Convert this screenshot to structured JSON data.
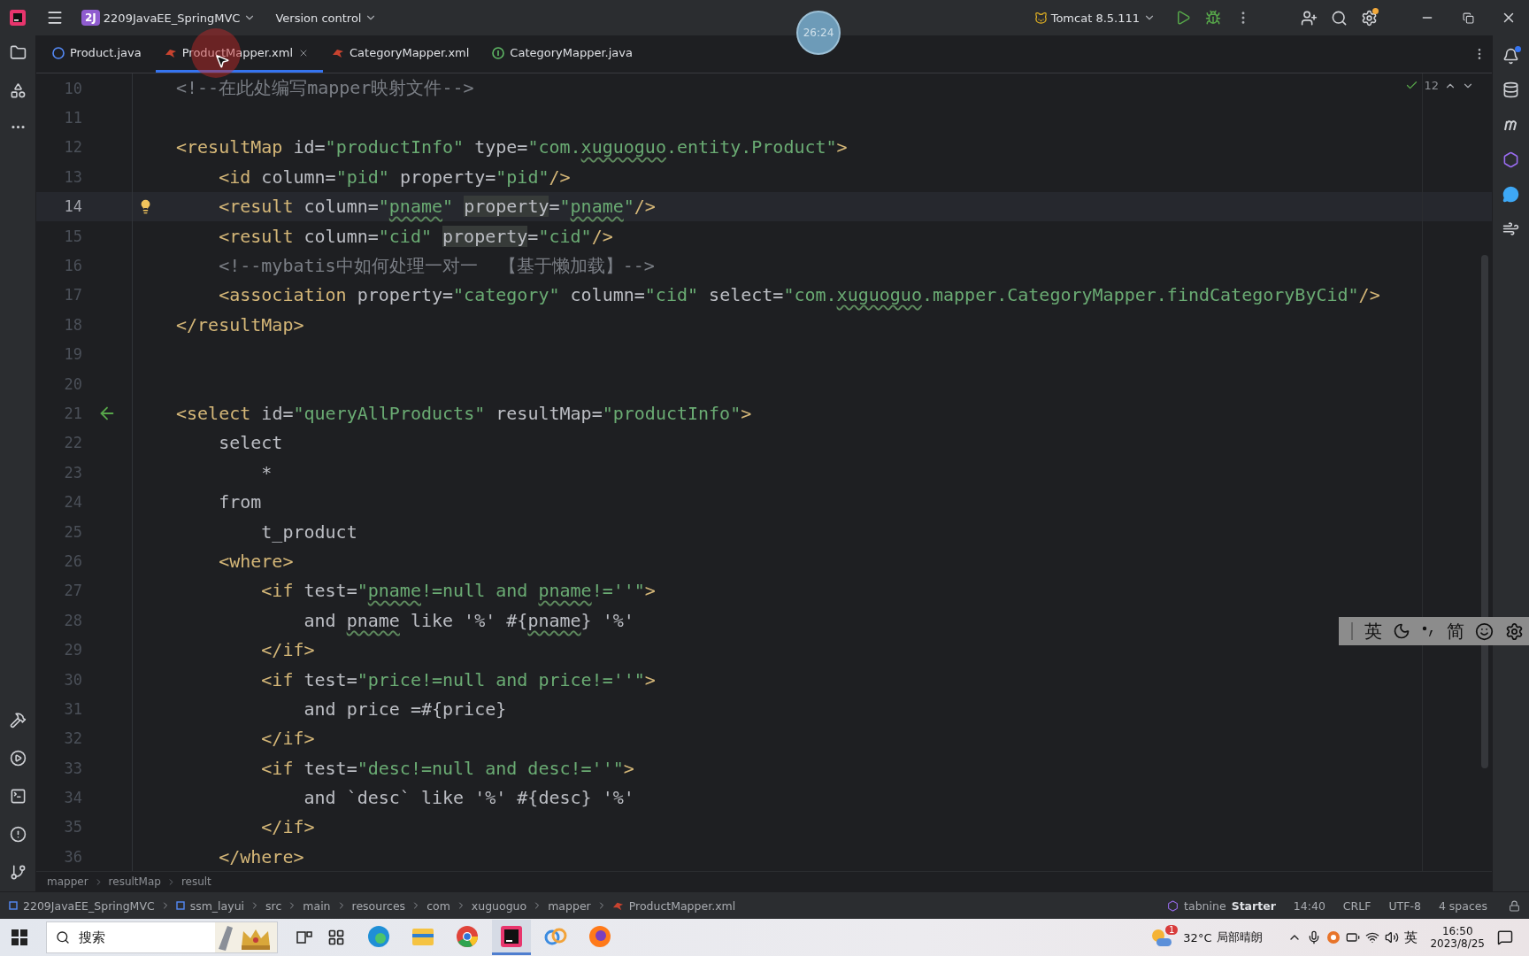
{
  "title_bar": {
    "project_badge": "2J",
    "project": "2209JavaEE_SpringMVC",
    "vcs": "Version control",
    "run_config": "Tomcat 8.5.111",
    "settings_badge": true
  },
  "recording_timer": "26:24",
  "tabs": [
    {
      "label": "Product.java",
      "kind": "java-class",
      "selected": false,
      "closable": false
    },
    {
      "label": "ProductMapper.xml",
      "kind": "xml",
      "selected": true,
      "closable": true
    },
    {
      "label": "CategoryMapper.xml",
      "kind": "xml",
      "selected": false,
      "closable": false
    },
    {
      "label": "CategoryMapper.java",
      "kind": "java-interface",
      "selected": false,
      "closable": false
    }
  ],
  "editor": {
    "inspections": "12",
    "lines": [
      {
        "number": "10",
        "current": false,
        "tokens": [
          {
            "kind": "comment",
            "text": "<!--在此处编写mapper映射文件-->"
          }
        ]
      },
      {
        "number": "11",
        "current": false
      },
      {
        "number": "12",
        "current": false,
        "tokens": [
          {
            "kind": "tag",
            "text": "<resultMap"
          },
          {
            "kind": "attr",
            "text": " id="
          },
          {
            "kind": "value",
            "text": "\"productInfo\""
          },
          {
            "kind": "attr",
            "text": " type="
          },
          {
            "kind": "value",
            "text": "\"com."
          },
          {
            "kind": "value",
            "text": "xuguoguo",
            "typo": true
          },
          {
            "kind": "value",
            "text": ".entity.Product\""
          },
          {
            "kind": "tag",
            "text": ">"
          }
        ]
      },
      {
        "number": "13",
        "current": false,
        "tokens": [
          {
            "kind": "tag",
            "text": "    <id"
          },
          {
            "kind": "attr",
            "text": " column="
          },
          {
            "kind": "value",
            "text": "\"pid\""
          },
          {
            "kind": "attr",
            "text": " property="
          },
          {
            "kind": "value",
            "text": "\"pid\""
          },
          {
            "kind": "tag",
            "text": "/>"
          }
        ]
      },
      {
        "number": "14",
        "current": true,
        "bulb": true,
        "tokens": [
          {
            "kind": "tag",
            "text": "    <result"
          },
          {
            "kind": "attr",
            "text": " column="
          },
          {
            "kind": "value",
            "text": "\""
          },
          {
            "kind": "value",
            "text": "pname",
            "typo": true
          },
          {
            "kind": "value",
            "text": "\" "
          },
          {
            "kind": "attr",
            "text": "property",
            "highlighted": true
          },
          {
            "kind": "attr",
            "text": "="
          },
          {
            "kind": "value",
            "text": "\""
          },
          {
            "kind": "value",
            "text": "pname",
            "typo": true
          },
          {
            "kind": "value",
            "text": "\""
          },
          {
            "kind": "tag",
            "text": "/>"
          }
        ]
      },
      {
        "number": "15",
        "current": false,
        "tokens": [
          {
            "kind": "tag",
            "text": "    <result"
          },
          {
            "kind": "attr",
            "text": " column="
          },
          {
            "kind": "value",
            "text": "\"cid\" "
          },
          {
            "kind": "attr",
            "text": "property",
            "highlighted": true
          },
          {
            "kind": "attr",
            "text": "="
          },
          {
            "kind": "value",
            "text": "\"cid\""
          },
          {
            "kind": "tag",
            "text": "/>"
          }
        ]
      },
      {
        "number": "16",
        "current": false,
        "tokens": [
          {
            "kind": "comment",
            "text": "    <!--mybatis中如何处理一对一  【基于懒加载】-->"
          }
        ]
      },
      {
        "number": "17",
        "current": false,
        "tokens": [
          {
            "kind": "tag",
            "text": "    <association"
          },
          {
            "kind": "attr",
            "text": " property="
          },
          {
            "kind": "value",
            "text": "\"category\""
          },
          {
            "kind": "attr",
            "text": " column="
          },
          {
            "kind": "value",
            "text": "\"cid\""
          },
          {
            "kind": "attr",
            "text": " select="
          },
          {
            "kind": "value",
            "text": "\"com."
          },
          {
            "kind": "value",
            "text": "xuguoguo",
            "typo": true
          },
          {
            "kind": "value",
            "text": ".mapper.CategoryMapper.findCategoryByCid\""
          },
          {
            "kind": "tag",
            "text": "/>"
          }
        ]
      },
      {
        "number": "18",
        "current": false,
        "tokens": [
          {
            "kind": "tag",
            "text": "</resultMap>"
          }
        ]
      },
      {
        "number": "19",
        "current": false
      },
      {
        "number": "20",
        "current": false
      },
      {
        "number": "21",
        "current": false,
        "arrow": true,
        "tokens": [
          {
            "kind": "tag",
            "text": "<select"
          },
          {
            "kind": "attr",
            "text": " id="
          },
          {
            "kind": "value",
            "text": "\"queryAllProducts\""
          },
          {
            "kind": "attr",
            "text": " resultMap="
          },
          {
            "kind": "value",
            "text": "\"productInfo\""
          },
          {
            "kind": "tag",
            "text": ">"
          }
        ]
      },
      {
        "number": "22",
        "current": false,
        "tokens": [
          {
            "kind": "text",
            "text": "    select"
          }
        ]
      },
      {
        "number": "23",
        "current": false,
        "tokens": [
          {
            "kind": "text",
            "text": "        *"
          }
        ]
      },
      {
        "number": "24",
        "current": false,
        "tokens": [
          {
            "kind": "text",
            "text": "    from"
          }
        ]
      },
      {
        "number": "25",
        "current": false,
        "tokens": [
          {
            "kind": "text",
            "text": "        t_product"
          }
        ]
      },
      {
        "number": "26",
        "current": false,
        "tokens": [
          {
            "kind": "tag",
            "text": "    <where>"
          }
        ]
      },
      {
        "number": "27",
        "current": false,
        "tokens": [
          {
            "kind": "tag",
            "text": "        <if"
          },
          {
            "kind": "attr",
            "text": " test="
          },
          {
            "kind": "value",
            "text": "\""
          },
          {
            "kind": "value",
            "text": "pname",
            "typo": true
          },
          {
            "kind": "value",
            "text": "!=null and "
          },
          {
            "kind": "value",
            "text": "pname",
            "typo": true
          },
          {
            "kind": "value",
            "text": "!=''\""
          },
          {
            "kind": "tag",
            "text": ">"
          }
        ]
      },
      {
        "number": "28",
        "current": false,
        "tokens": [
          {
            "kind": "text",
            "text": "            and "
          },
          {
            "kind": "text",
            "text": "pname",
            "typo": true
          },
          {
            "kind": "text",
            "text": " like '%' #{"
          },
          {
            "kind": "text",
            "text": "pname",
            "typo": true
          },
          {
            "kind": "text",
            "text": "} '%'"
          }
        ]
      },
      {
        "number": "29",
        "current": false,
        "tokens": [
          {
            "kind": "tag",
            "text": "        </if>"
          }
        ]
      },
      {
        "number": "30",
        "current": false,
        "tokens": [
          {
            "kind": "tag",
            "text": "        <if"
          },
          {
            "kind": "attr",
            "text": " test="
          },
          {
            "kind": "value",
            "text": "\"price!=null and price!=''\""
          },
          {
            "kind": "tag",
            "text": ">"
          }
        ]
      },
      {
        "number": "31",
        "current": false,
        "tokens": [
          {
            "kind": "text",
            "text": "            and price =#{price}"
          }
        ]
      },
      {
        "number": "32",
        "current": false,
        "tokens": [
          {
            "kind": "tag",
            "text": "        </if>"
          }
        ]
      },
      {
        "number": "33",
        "current": false,
        "tokens": [
          {
            "kind": "tag",
            "text": "        <if"
          },
          {
            "kind": "attr",
            "text": " test="
          },
          {
            "kind": "value",
            "text": "\"desc!=null and desc!=''\""
          },
          {
            "kind": "tag",
            "text": ">"
          }
        ]
      },
      {
        "number": "34",
        "current": false,
        "tokens": [
          {
            "kind": "text",
            "text": "            and `desc` like '%' #{desc} '%'"
          }
        ]
      },
      {
        "number": "35",
        "current": false,
        "tokens": [
          {
            "kind": "tag",
            "text": "        </if>"
          }
        ]
      },
      {
        "number": "36",
        "current": false,
        "tokens": [
          {
            "kind": "tag",
            "text": "    </where>"
          }
        ]
      }
    ]
  },
  "ime_toolbar": {
    "language": "英",
    "script": "简"
  },
  "notifications_badge": true,
  "breadcrumbs": [
    "mapper",
    "resultMap",
    "result"
  ],
  "status_bar": {
    "path": [
      {
        "label": "2209JavaEE_SpringMVC",
        "kind": "module"
      },
      {
        "label": "ssm_layui",
        "kind": "module"
      },
      {
        "label": "src",
        "kind": "folder"
      },
      {
        "label": "main",
        "kind": "folder"
      },
      {
        "label": "resources",
        "kind": "folder"
      },
      {
        "label": "com",
        "kind": "folder"
      },
      {
        "label": "xuguoguo",
        "kind": "folder"
      },
      {
        "label": "mapper",
        "kind": "folder"
      },
      {
        "label": "ProductMapper.xml",
        "kind": "file"
      }
    ],
    "plugin_name": "tabnine",
    "plugin_plan": "Starter",
    "position": "14:40",
    "line_separator": "CRLF",
    "encoding": "UTF-8",
    "indent": "4 spaces"
  },
  "taskbar": {
    "search_placeholder": "搜索",
    "apps": [
      {
        "kind": "edge",
        "selected": false
      },
      {
        "kind": "folder",
        "selected": false
      },
      {
        "kind": "chrome",
        "selected": false
      },
      {
        "kind": "ide",
        "selected": true
      },
      {
        "kind": "rings",
        "selected": false
      },
      {
        "kind": "firefox",
        "selected": false
      }
    ],
    "weather_badge": "1",
    "temperature": "32°C",
    "condition": "局部晴朗",
    "input_language": "英",
    "time": "16:50",
    "date": "2023/8/25"
  }
}
